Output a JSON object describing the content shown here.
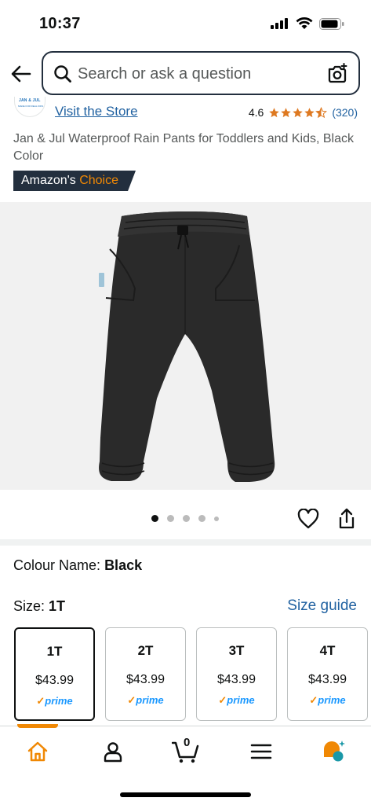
{
  "status_bar": {
    "time": "10:37"
  },
  "search": {
    "placeholder": "Search or ask a question"
  },
  "store": {
    "logo_text": "JAN & JUL",
    "logo_subtext": "MADE FOR REAL KIDS",
    "visit_label": "Visit the Store"
  },
  "rating": {
    "value": "4.6",
    "stars": 4.5,
    "count": "(320)"
  },
  "product": {
    "title": "Jan & Jul Waterproof Rain Pants for Toddlers and Kids, Black Color"
  },
  "badge": {
    "part1": "Amazon's",
    "part2": "Choice"
  },
  "gallery": {
    "image_count": 5,
    "active_index": 0
  },
  "colour": {
    "label": "Colour Name:",
    "value": "Black"
  },
  "size": {
    "label": "Size:",
    "value": "1T",
    "guide_label": "Size guide",
    "options": [
      {
        "label": "1T",
        "price": "$43.99",
        "prime": "prime",
        "selected": true
      },
      {
        "label": "2T",
        "price": "$43.99",
        "prime": "prime",
        "selected": false
      },
      {
        "label": "3T",
        "price": "$43.99",
        "prime": "prime",
        "selected": false
      },
      {
        "label": "4T",
        "price": "$43.99",
        "prime": "prime",
        "selected": false
      }
    ]
  },
  "bottom_nav": {
    "items": [
      "home-icon",
      "account-icon",
      "cart-icon",
      "menu-icon",
      "rufus-ai-icon"
    ],
    "cart_count": "0",
    "active": "home"
  },
  "colors": {
    "accent": "#f08804",
    "link": "#2162a1",
    "dark": "#232f3e",
    "prime_blue": "#1a98ff"
  }
}
